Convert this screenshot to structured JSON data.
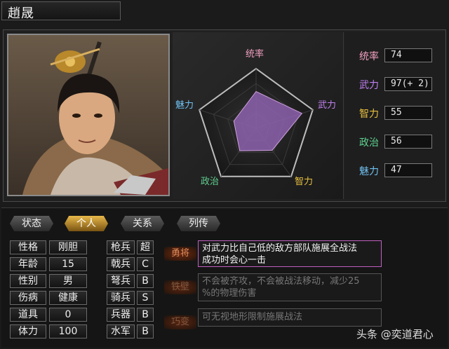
{
  "officer": {
    "name": "趙晟"
  },
  "radar_labels": {
    "leadership": "统率",
    "war": "武力",
    "intelligence": "智力",
    "politics": "政治",
    "charm": "魅力"
  },
  "radar_values": {
    "leadership": 74,
    "war": 97,
    "intelligence": 55,
    "politics": 56,
    "charm": 47
  },
  "colors": {
    "leadership": "#f0a0c0",
    "war": "#c080f0",
    "intelligence": "#e8c040",
    "politics": "#60d090",
    "charm": "#70c0f0"
  },
  "stats": [
    {
      "label": "统率",
      "value": "74"
    },
    {
      "label": "武力",
      "value": "97(+ 2)"
    },
    {
      "label": "智力",
      "value": "55"
    },
    {
      "label": "政治",
      "value": "56"
    },
    {
      "label": "魅力",
      "value": "47"
    }
  ],
  "tabs": [
    "状态",
    "个人",
    "关系",
    "列传"
  ],
  "active_tab": "个人",
  "personal": [
    {
      "label": "性格",
      "value": "刚胆"
    },
    {
      "label": "年龄",
      "value": "15"
    },
    {
      "label": "性别",
      "value": "男"
    },
    {
      "label": "伤病",
      "value": "健康"
    },
    {
      "label": "道具",
      "value": "0"
    },
    {
      "label": "体力",
      "value": "100"
    }
  ],
  "aptitudes": [
    {
      "label": "枪兵",
      "value": "超"
    },
    {
      "label": "戟兵",
      "value": "C"
    },
    {
      "label": "弩兵",
      "value": "B"
    },
    {
      "label": "骑兵",
      "value": "S"
    },
    {
      "label": "兵器",
      "value": "B"
    },
    {
      "label": "水军",
      "value": "B"
    }
  ],
  "skills": [
    {
      "name": "勇将",
      "desc_line1": "对武力比自己低的敌方部队施展全战法",
      "desc_line2": "成功时会心一击"
    },
    {
      "name": "铁壁",
      "desc_line1": "不会被齐攻，不会被战法移动，减少25",
      "desc_line2": "%的物理伤害"
    },
    {
      "name": "巧变",
      "desc_line1": "可无视地形限制施展战法",
      "desc_line2": ""
    }
  ],
  "watermark": "头条 @奕道君心"
}
